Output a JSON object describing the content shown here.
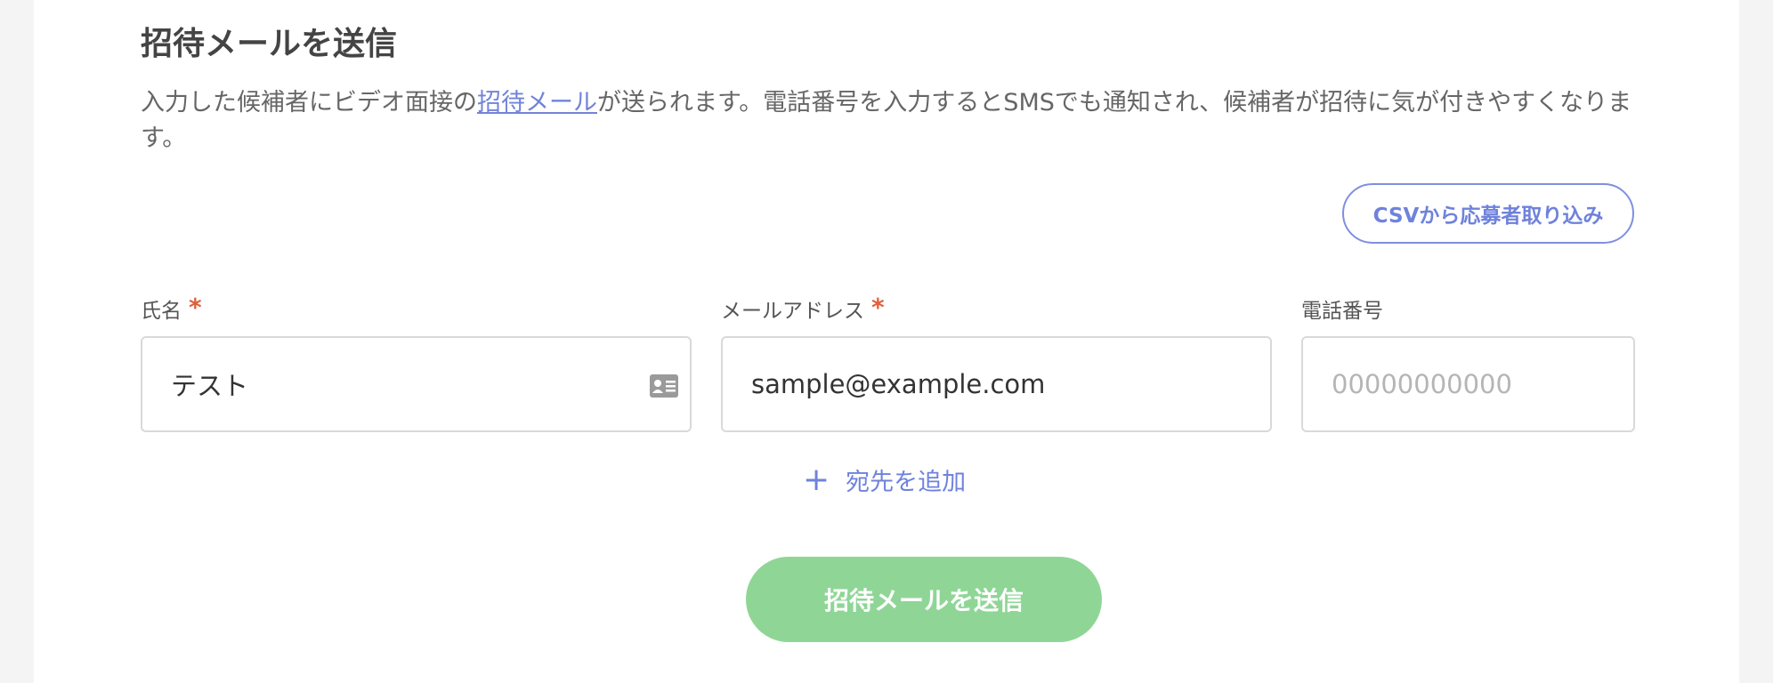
{
  "section": {
    "title": "招待メールを送信",
    "description_before": "入力した候補者にビデオ面接の",
    "description_link": "招待メール",
    "description_after": "が送られます。電話番号を入力するとSMSでも通知され、候補者が招待に気が付きやすくなります。"
  },
  "csv_import_label": "CSVから応募者取り込み",
  "fields": {
    "name": {
      "label": "氏名",
      "required_mark": "*",
      "value": "テスト",
      "icon": "id-card-icon"
    },
    "email": {
      "label": "メールアドレス",
      "required_mark": "*",
      "value": "sample@example.com"
    },
    "phone": {
      "label": "電話番号",
      "placeholder": "00000000000"
    }
  },
  "add_destination": {
    "icon": "plus-icon",
    "label": "宛先を追加"
  },
  "submit_label": "招待メールを送信",
  "colors": {
    "accent": "#6f82dc",
    "required": "#e0603a",
    "submit_bg": "#8fd696"
  }
}
